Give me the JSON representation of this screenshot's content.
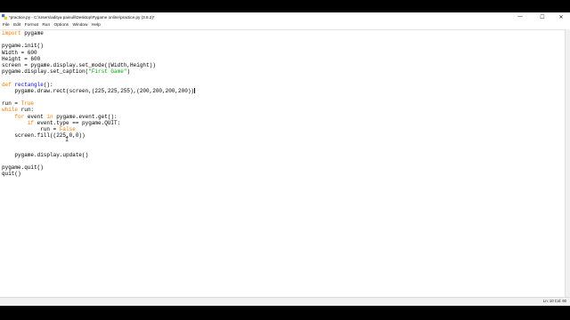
{
  "window": {
    "title": "*practice.py - C:\\Users\\aditya painuli\\Desktop\\Pygame online\\practice.py (3.8.2)*",
    "controls": {
      "minimize": "—",
      "maximize": "☐",
      "close": "✕"
    }
  },
  "menu": [
    "File",
    "Edit",
    "Format",
    "Run",
    "Options",
    "Window",
    "Help"
  ],
  "code": {
    "l1_kw": "import",
    "l1_rest": " pygame",
    "l3": "pygame.init()",
    "l4": "Width = 600",
    "l5": "Height = 600",
    "l6": "screen = pygame.display.set_mode((Width,Height))",
    "l7_a": "pygame.display.set_caption(",
    "l7_str": "\"First Game\"",
    "l7_b": ")",
    "l9_kw": "def",
    "l9_sp": " ",
    "l9_fn": "rectangle",
    "l9_b": "():",
    "l10": "    pygame.draw.rect(screen,(225,225,255),(200,200,200,200))",
    "l12_a": "run = ",
    "l12_kw": "True",
    "l13_kw": "while",
    "l13_b": " run:",
    "l14_ind": "    ",
    "l14_kw": "for",
    "l14_b": " event ",
    "l14_kw2": "in",
    "l14_c": " pygame.event.get():",
    "l15_ind": "        ",
    "l15_kw": "if",
    "l15_b": " event.type == pygame.QUIT:",
    "l16_a": "            run = ",
    "l16_kw": "False",
    "l17": "    screen.fill((225,0,0))",
    "l20": "    pygame.display.update()",
    "l22": "pygame.quit()",
    "l23": "quit()"
  },
  "status": {
    "position": "Ln: 10   Col: 60"
  }
}
